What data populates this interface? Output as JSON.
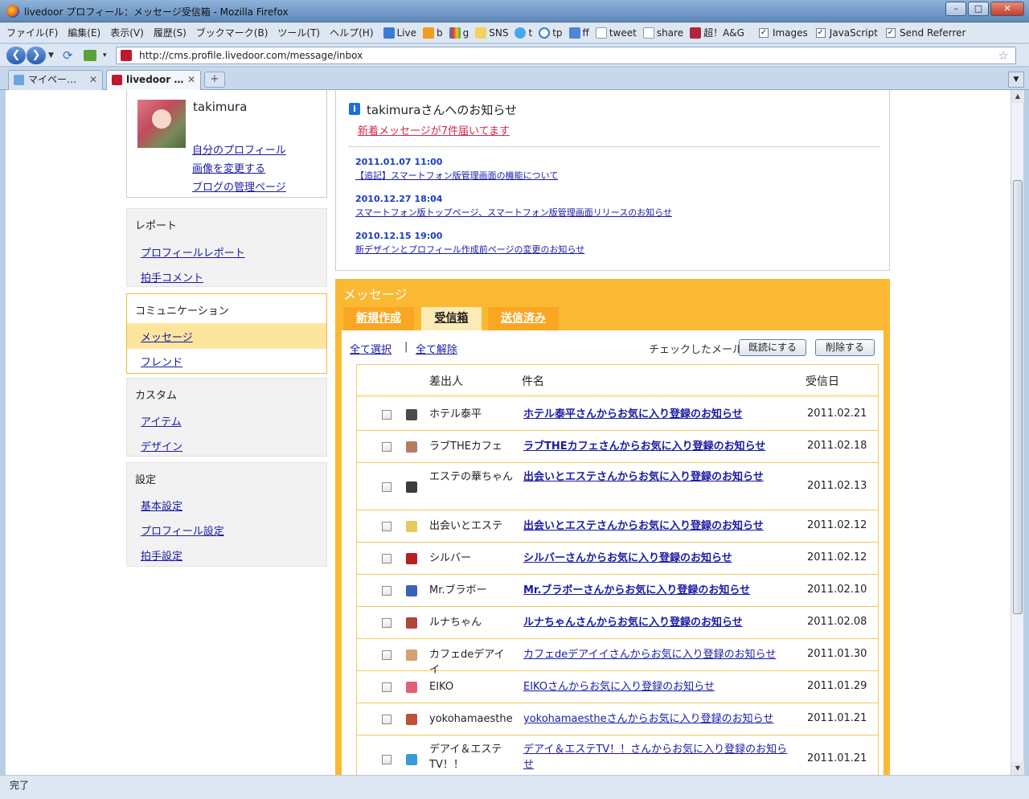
{
  "window": {
    "title": "livedoor プロフィール：メッセージ受信箱 - Mozilla Firefox"
  },
  "menu": [
    "ファイル(F)",
    "編集(E)",
    "表示(V)",
    "履歴(S)",
    "ブックマーク(B)",
    "ツール(T)",
    "ヘルプ(H)"
  ],
  "bookmarks": [
    "Live",
    "b",
    "g",
    "SNS",
    "t",
    "tp",
    "ff",
    "tweet",
    "share",
    "超！A&G"
  ],
  "toggles": [
    "Images",
    "JavaScript",
    "Send Referrer"
  ],
  "url": "http://cms.profile.livedoor.com/message/inbox",
  "tabs": [
    "マイペー…",
    "livedoor …"
  ],
  "status": "完了",
  "profile": {
    "username": "takimura",
    "links": [
      "自分のプロフィール",
      "画像を変更する",
      "ブログの管理ページ"
    ]
  },
  "sidebar": [
    {
      "heading": "レポート",
      "items": [
        "プロフィールレポート",
        "拍手コメント"
      ]
    },
    {
      "heading": "コミュニケーション",
      "items": [
        "メッセージ",
        "フレンド"
      ]
    },
    {
      "heading": "カスタム",
      "items": [
        "アイテム",
        "デザイン"
      ]
    },
    {
      "heading": "設定",
      "items": [
        "基本設定",
        "プロフィール設定",
        "拍手設定"
      ]
    }
  ],
  "notice": {
    "title": "takimuraさんへのお知らせ",
    "new_message": "新着メッセージが7件届いてます",
    "news": [
      {
        "date": "2011.01.07 11:00",
        "text": "【追記】スマートフォン版管理画面の機能について"
      },
      {
        "date": "2010.12.27 18:04",
        "text": "スマートフォン版トップページ、スマートフォン版管理画面リリースのお知らせ"
      },
      {
        "date": "2010.12.15 19:00",
        "text": "新デザインとプロフィール作成前ページの変更のお知らせ"
      }
    ]
  },
  "messages": {
    "title": "メッセージ",
    "tabs": [
      "新規作成",
      "受信箱",
      "送信済み"
    ],
    "select_all": "全て選択",
    "deselect_all": "全て解除",
    "checked_label": "チェックしたメールを",
    "mark_read": "既読にする",
    "delete": "削除する",
    "columns": {
      "sender": "差出人",
      "subject": "件名",
      "date": "受信日"
    },
    "rows": [
      {
        "sender": "ホテル泰平",
        "subject": "ホテル泰平さんからお気に入り登録のお知らせ",
        "date": "2011.02.21",
        "unread": true,
        "icon_color": "#4a4a4a"
      },
      {
        "sender": "ラブTHEカフェ",
        "subject": "ラブTHEカフェさんからお気に入り登録のお知らせ",
        "date": "2011.02.18",
        "unread": true,
        "icon_color": "#b77a63"
      },
      {
        "sender": "エステの華ちゃん",
        "subject": "出会いとエステさんからお気に入り登録のお知らせ",
        "date": "2011.02.13",
        "unread": true,
        "icon_color": "#3c3c3c"
      },
      {
        "sender": "出会いとエステ",
        "subject": "出会いとエステさんからお気に入り登録のお知らせ",
        "date": "2011.02.12",
        "unread": true,
        "icon_color": "#e8c85a"
      },
      {
        "sender": "シルバー",
        "subject": "シルバーさんからお気に入り登録のお知らせ",
        "date": "2011.02.12",
        "unread": true,
        "icon_color": "#b81f1f"
      },
      {
        "sender": "Mr.ブラボー",
        "subject": "Mr.ブラボーさんからお気に入り登録のお知らせ",
        "date": "2011.02.10",
        "unread": true,
        "icon_color": "#3a63b8"
      },
      {
        "sender": "ルナちゃん",
        "subject": "ルナちゃんさんからお気に入り登録のお知らせ",
        "date": "2011.02.08",
        "unread": true,
        "icon_color": "#b0453a"
      },
      {
        "sender": "カフェdeデアイイ",
        "subject": "カフェdeデアイイさんからお気に入り登録のお知らせ",
        "date": "2011.01.30",
        "unread": false,
        "icon_color": "#d4a070"
      },
      {
        "sender": "EIKO",
        "subject": "EIKOさんからお気に入り登録のお知らせ",
        "date": "2011.01.29",
        "unread": false,
        "icon_color": "#e0607a"
      },
      {
        "sender": "yokohamaesthe",
        "subject": "yokohamaestheさんからお気に入り登録のお知らせ",
        "date": "2011.01.21",
        "unread": false,
        "icon_color": "#c0503a"
      },
      {
        "sender": "デアイ＆エステTV！！",
        "subject": "デアイ＆エステTV！！さんからお気に入り登録のお知らせ",
        "date": "2011.01.21",
        "unread": false,
        "icon_color": "#3a9ad8"
      }
    ]
  }
}
